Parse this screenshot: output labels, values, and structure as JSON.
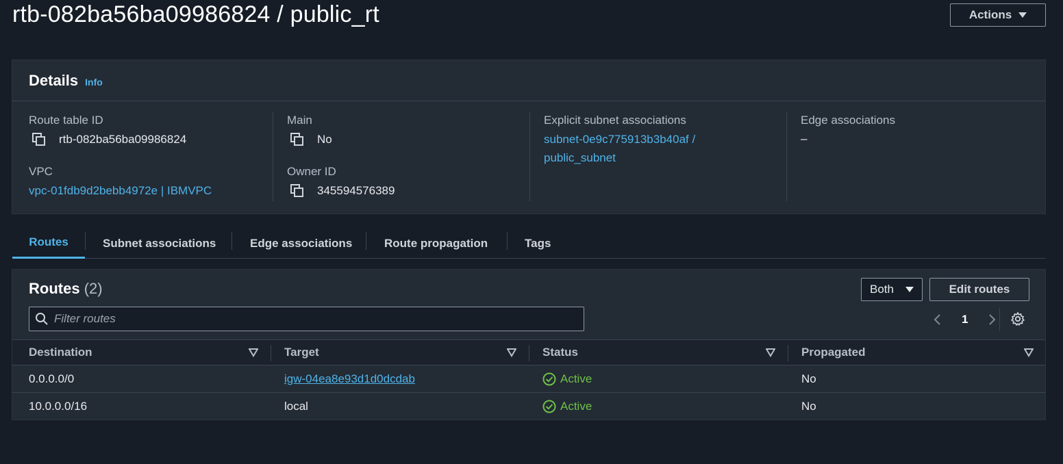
{
  "header": {
    "title": "rtb-082ba56ba09986824 / public_rt",
    "actions_label": "Actions"
  },
  "details": {
    "title": "Details",
    "info_label": "Info",
    "route_table_id_label": "Route table ID",
    "route_table_id": "rtb-082ba56ba09986824",
    "vpc_label": "VPC",
    "vpc_value": "vpc-01fdb9d2bebb4972e | IBMVPC",
    "main_label": "Main",
    "main_value": "No",
    "owner_id_label": "Owner ID",
    "owner_id": "345594576389",
    "explicit_subnet_label": "Explicit subnet associations",
    "explicit_subnet_line1": "subnet-0e9c775913b3b40af /",
    "explicit_subnet_line2": "public_subnet",
    "edge_label": "Edge associations",
    "edge_value": "–"
  },
  "tabs": [
    {
      "label": "Routes",
      "active": true
    },
    {
      "label": "Subnet associations",
      "active": false
    },
    {
      "label": "Edge associations",
      "active": false
    },
    {
      "label": "Route propagation",
      "active": false
    },
    {
      "label": "Tags",
      "active": false
    }
  ],
  "routes": {
    "title": "Routes",
    "count": "(2)",
    "filter_select": "Both",
    "edit_label": "Edit routes",
    "filter_placeholder": "Filter routes",
    "page": "1",
    "columns": [
      "Destination",
      "Target",
      "Status",
      "Propagated"
    ],
    "rows": [
      {
        "destination": "0.0.0.0/0",
        "target": "igw-04ea8e93d1d0dcdab",
        "target_is_link": true,
        "status": "Active",
        "propagated": "No"
      },
      {
        "destination": "10.0.0.0/16",
        "target": "local",
        "target_is_link": false,
        "status": "Active",
        "propagated": "No"
      }
    ]
  },
  "colors": {
    "background": "#161d26",
    "panel": "#232b35",
    "link": "#4fb4e8",
    "success": "#6fc048"
  }
}
